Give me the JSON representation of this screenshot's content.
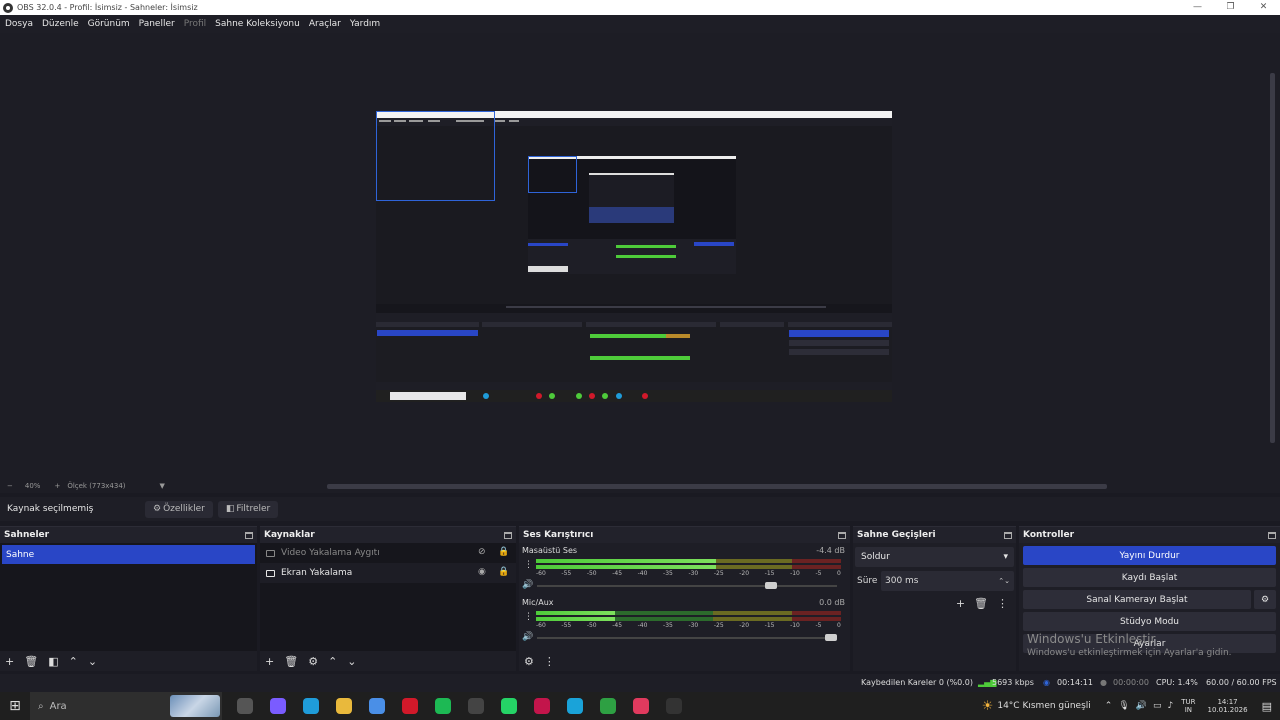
{
  "window": {
    "title": "OBS 32.0.4 - Profil: İsimsiz - Sahneler: İsimsiz",
    "controls": [
      "—",
      "❐",
      "✕"
    ]
  },
  "menu": [
    "Dosya",
    "Düzenle",
    "Görünüm",
    "Paneller",
    "Profil",
    "Sahne Koleksiyonu",
    "Araçlar",
    "Yardım"
  ],
  "zoom": {
    "minus": "−",
    "value": "40%",
    "plus": "+",
    "scale_label": "Ölçek (773x434)",
    "dropdown": "▼"
  },
  "properties_bar": {
    "no_source": "Kaynak seçilmemiş",
    "properties": "Özellikler",
    "filters": "Filtreler"
  },
  "scenes": {
    "title": "Sahneler",
    "items": [
      "Sahne"
    ]
  },
  "sources": {
    "title": "Kaynaklar",
    "items": [
      {
        "label": "Video Yakalama Aygıtı",
        "visible": false
      },
      {
        "label": "Ekran Yakalama",
        "visible": true
      }
    ]
  },
  "mixer": {
    "title": "Ses Karıştırıcı",
    "channels": [
      {
        "name": "Masaüstü Ses",
        "db": "-4.4 dB",
        "level": 0.59,
        "volume": 0.8
      },
      {
        "name": "Mic/Aux",
        "db": "0.0 dB",
        "level": 0.26,
        "volume": 1.0
      }
    ],
    "ticks": [
      "-60",
      "-55",
      "-50",
      "-45",
      "-40",
      "-35",
      "-30",
      "-25",
      "-20",
      "-15",
      "-10",
      "-5",
      "0"
    ]
  },
  "transitions": {
    "title": "Sahne Geçişleri",
    "type": "Soldur",
    "duration_label": "Süre",
    "duration": "300 ms"
  },
  "controls": {
    "title": "Kontroller",
    "stream": "Yayını Durdur",
    "record": "Kaydı Başlat",
    "virtual_cam": "Sanal Kamerayı Başlat",
    "studio": "Stüdyo Modu",
    "settings": "Ayarlar"
  },
  "activation": {
    "title": "Windows'u Etkinleştir",
    "sub": "Windows'u etkinleştirmek için Ayarlar'a gidin."
  },
  "status": {
    "dropped": "Kaybedilen Kareler 0 (%0.0)",
    "bitrate": "5693 kbps",
    "stream_time": "00:14:11",
    "rec_time": "00:00:00",
    "cpu": "CPU: 1.4%",
    "fps": "60.00 / 60.00 FPS"
  },
  "taskbar": {
    "search": "Ara",
    "weather": "14°C  Kısmen güneşli",
    "lang": "TUR",
    "lang2": "IN",
    "time": "14:17",
    "date": "10.01.2026",
    "apps": [
      {
        "name": "task-view-icon",
        "color": "#555555"
      },
      {
        "name": "copilot-icon",
        "color": "#7a5cff"
      },
      {
        "name": "edge-icon",
        "color": "#1f9cd9"
      },
      {
        "name": "file-explorer-icon",
        "color": "#e9b93c"
      },
      {
        "name": "store-icon",
        "color": "#4a8fe7"
      },
      {
        "name": "opera-icon",
        "color": "#d1192a"
      },
      {
        "name": "spotify-icon",
        "color": "#1db954"
      },
      {
        "name": "app-eng-icon",
        "color": "#444444"
      },
      {
        "name": "whatsapp-icon",
        "color": "#25d366"
      },
      {
        "name": "app-red-icon",
        "color": "#c3154b"
      },
      {
        "name": "app-cyan-icon",
        "color": "#1aa3d9"
      },
      {
        "name": "xbox-icon",
        "color": "#2ea043"
      },
      {
        "name": "app-pink-icon",
        "color": "#e03a5e"
      },
      {
        "name": "obs-icon",
        "color": "#333333"
      }
    ]
  }
}
